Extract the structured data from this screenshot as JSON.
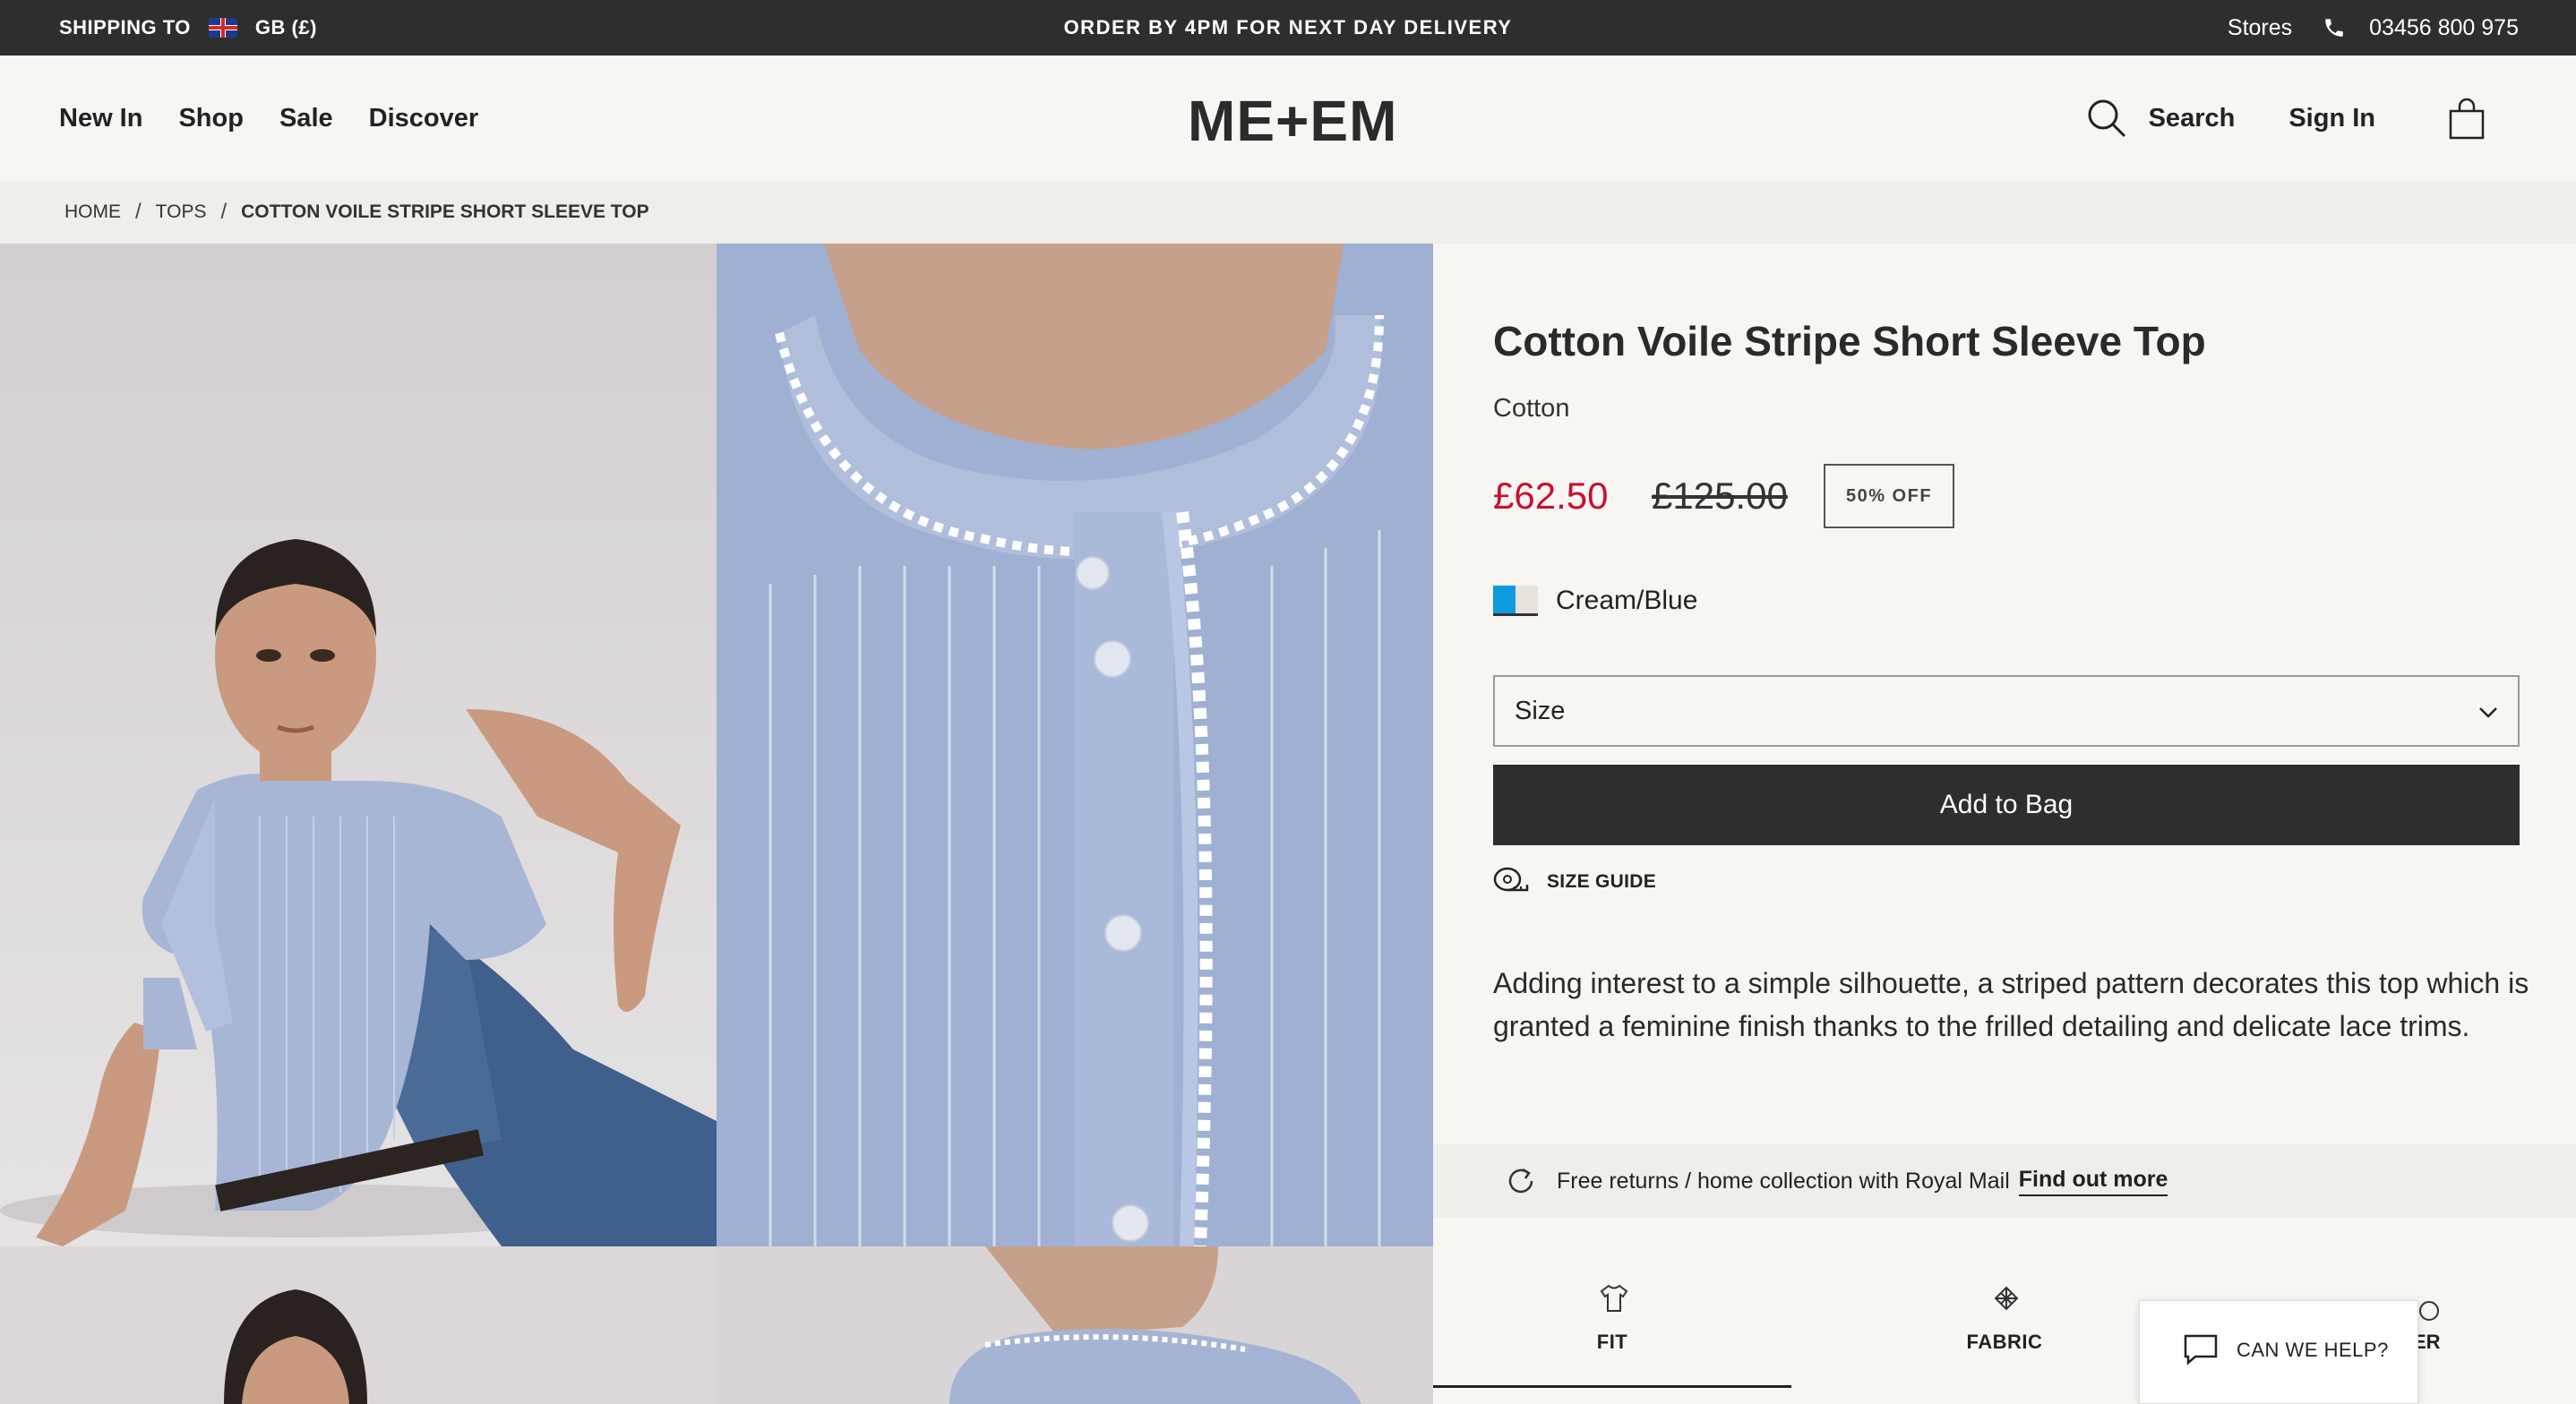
{
  "topbar": {
    "shipping_label": "SHIPPING TO",
    "region": "GB (£)",
    "promo": "ORDER BY 4PM FOR NEXT DAY DELIVERY",
    "stores": "Stores",
    "phone": "03456 800 975"
  },
  "header": {
    "nav": [
      "New In",
      "Shop",
      "Sale",
      "Discover"
    ],
    "logo": "ME+EM",
    "search": "Search",
    "sign_in": "Sign In"
  },
  "breadcrumb": {
    "items": [
      "HOME",
      "TOPS",
      "COTTON VOILE STRIPE SHORT SLEEVE TOP"
    ],
    "separator": "/"
  },
  "product": {
    "title": "Cotton Voile Stripe Short Sleeve Top",
    "material": "Cotton",
    "price": "£62.50",
    "was_price": "£125.00",
    "discount": "50% OFF",
    "colour_name": "Cream/Blue",
    "swatch_colors": [
      "#0d9be0",
      "#e6e3dc"
    ],
    "size_label": "Size",
    "add_to_bag": "Add to Bag",
    "size_guide": "SIZE GUIDE",
    "description": "Adding interest to a simple silhouette, a striped pattern decorates this top which is granted a feminine finish thanks to the frilled detailing and delicate lace trims.",
    "returns_text": "Free returns / home collection with Royal Mail",
    "returns_link": "Find out more"
  },
  "tabs": [
    {
      "label": "FIT",
      "icon": "tshirt-icon"
    },
    {
      "label": "FABRIC",
      "icon": "fabric-icon"
    },
    {
      "label": "ER",
      "icon": "care-icon"
    }
  ],
  "help": {
    "label": "CAN WE HELP?"
  },
  "colors": {
    "accent_sale": "#c8102e",
    "dark": "#2e2e2e",
    "background": "#f7f6f3"
  }
}
